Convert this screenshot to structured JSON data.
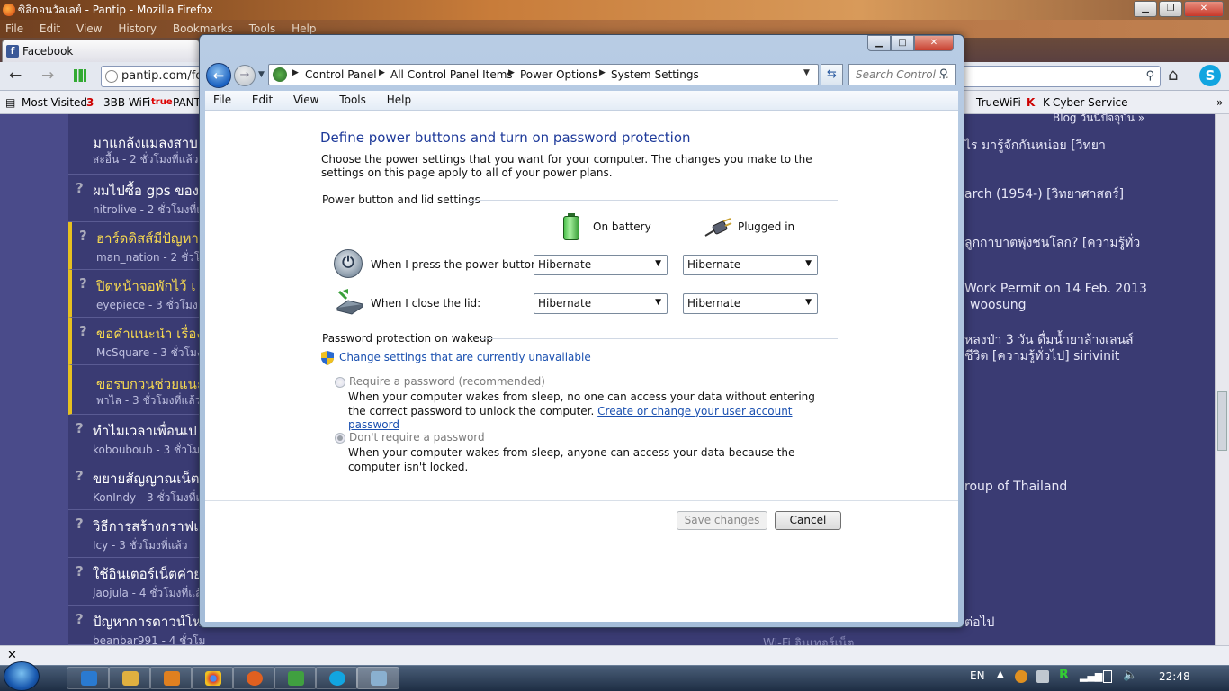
{
  "firefox": {
    "title": "ซิลิกอนวัลเลย์ - Pantip - Mozilla Firefox",
    "menu": [
      "File",
      "Edit",
      "View",
      "History",
      "Bookmarks",
      "Tools",
      "Help"
    ],
    "tab_label": "Facebook",
    "url": "pantip.com/for",
    "bookmarks": [
      "Most Visited",
      "3BB WiFi",
      "PANT",
      "TrueWiFi",
      "K-Cyber Service"
    ]
  },
  "pantip": {
    "topics": [
      {
        "title": "มาแกล้งแมลงสาบ",
        "user": "สะอื้น - 2 ชั่วโมงที่แล้ว",
        "highlight": false
      },
      {
        "title": "ผมไปซื้อ gps ของ",
        "user": "nitrolive - 2 ชั่วโมงที่แล้ว",
        "highlight": false
      },
      {
        "title": "ฮาร์ดดิสส์มีปัญหา",
        "user": "man_nation - 2 ชั่วโมง",
        "highlight": true
      },
      {
        "title": "ปิดหน้าจอพักไว้ เ",
        "user": "eyepiece - 3 ชั่วโมง",
        "highlight": true
      },
      {
        "title": "ขอคำแนะนำ เรื่อง",
        "user": "McSquare - 3 ชั่วโมง",
        "highlight": true
      },
      {
        "title": "ขอรบกวนช่วยแนะ",
        "user": "พาไล - 3 ชั่วโมงที่แล้ว",
        "highlight": true
      },
      {
        "title": "ทำไมเวลาเพื่อนเป",
        "user": "kobouboub - 3 ชั่วโมง",
        "highlight": false
      },
      {
        "title": "ขยายสัญญาณเน็ต",
        "user": "KonIndy - 3 ชั่วโมงที่แล้ว",
        "highlight": false
      },
      {
        "title": "วิธีการสร้างกราฟแ",
        "user": "Icy - 3 ชั่วโมงที่แล้ว",
        "highlight": false
      },
      {
        "title": "ใช้อินเตอร์เน็ตค่าย",
        "user": "Jaojula - 4 ชั่วโมงที่แล้ว",
        "highlight": false
      },
      {
        "title": "ปัญหาการดาวน์โห",
        "user": "beanbar991 - 4 ชั่วโมงที่แล้ว",
        "highlight": false
      }
    ],
    "right_items": [
      "Blog วันนี้ปัจจุบัน »",
      "ไร มารู้จักกันหน่อย [วิทยา",
      "arch (1954-) [วิทยาศาสตร์]",
      "ลูกกาบาตพุ่งชนโลก? [ความรู้ทั่ว",
      "Work Permit on 14 Feb. 2013",
      "woosung",
      "หลงป่า 3 วัน ดื่มน้ำยาล้างเลนส์",
      "ชีวิต [ความรู้ทั่วไป] sirivinit",
      "roup of Thailand",
      "ต่อไป",
      "Wi-Fi  อินเทอร์เน็ต"
    ]
  },
  "taskbar": {
    "lang": "EN",
    "clock": "22:48"
  },
  "window": {
    "breadcrumb": [
      "Control Panel",
      "All Control Panel Items",
      "Power Options",
      "System Settings"
    ],
    "search_placeholder": "Search Control ...",
    "menu": [
      "File",
      "Edit",
      "View",
      "Tools",
      "Help"
    ],
    "heading": "Define power buttons and turn on password protection",
    "description": "Choose the power settings that you want for your computer. The changes you make to the settings on this page apply to all of your power plans.",
    "power_group": "Power button and lid settings",
    "col_battery": "On battery",
    "col_plugged": "Plugged in",
    "power_button_label": "When I press the power button:",
    "lid_label": "When I close the lid:",
    "power_button_battery": "Hibernate",
    "power_button_plugged": "Hibernate",
    "lid_battery": "Hibernate",
    "lid_plugged": "Hibernate",
    "password_group": "Password protection on wakeup",
    "change_link": "Change settings that are currently unavailable",
    "require_label": "Require a password (recommended)",
    "require_desc": "When your computer wakes from sleep, no one can access your data without entering the correct password to unlock the computer.",
    "require_link": "Create or change your user account password",
    "norequire_label": "Don't require a password",
    "norequire_desc": "When your computer wakes from sleep, anyone can access your data because the computer isn't locked.",
    "save_button": "Save changes",
    "cancel_button": "Cancel"
  }
}
